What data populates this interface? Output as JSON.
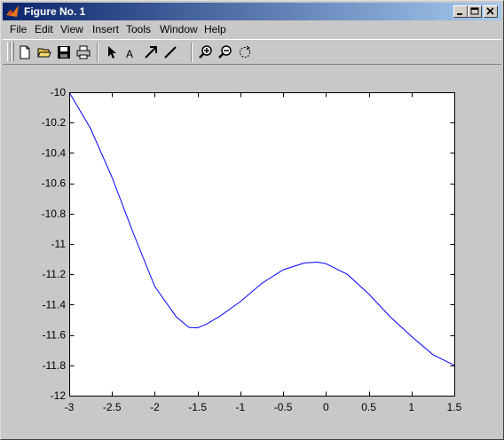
{
  "window": {
    "title": "Figure No. 1"
  },
  "menu": {
    "items": [
      "File",
      "Edit",
      "View",
      "Insert",
      "Tools",
      "Window",
      "Help"
    ]
  },
  "toolbar": {
    "buttons": [
      {
        "name": "new-figure-button",
        "icon": "new-file-icon"
      },
      {
        "name": "open-file-button",
        "icon": "open-folder-icon"
      },
      {
        "name": "save-button",
        "icon": "save-icon"
      },
      {
        "name": "print-button",
        "icon": "print-icon"
      },
      {
        "name": "edit-plot-button",
        "icon": "arrow-pointer-icon"
      },
      {
        "name": "insert-text-button",
        "icon": "text-icon",
        "label": "A"
      },
      {
        "name": "insert-arrow-button",
        "icon": "arrow-icon"
      },
      {
        "name": "insert-line-button",
        "icon": "line-icon"
      },
      {
        "name": "zoom-in-button",
        "icon": "zoom-in-icon"
      },
      {
        "name": "zoom-out-button",
        "icon": "zoom-out-icon"
      },
      {
        "name": "rotate-button",
        "icon": "rotate-icon"
      }
    ]
  },
  "chart_data": {
    "type": "line",
    "title": "",
    "xlabel": "",
    "ylabel": "",
    "xlim": [
      -3,
      1.5
    ],
    "ylim": [
      -12,
      -10
    ],
    "xticks": [
      -3,
      -2.5,
      -2,
      -1.5,
      -1,
      -0.5,
      0,
      0.5,
      1,
      1.5
    ],
    "xtick_labels": [
      "-3",
      "-2.5",
      "-2",
      "-1.5",
      "-1",
      "-0.5",
      "0",
      "0.5",
      "1",
      "1.5"
    ],
    "yticks": [
      -10,
      -10.2,
      -10.4,
      -10.6,
      -10.8,
      -11,
      -11.2,
      -11.4,
      -11.6,
      -11.8,
      -12
    ],
    "ytick_labels": [
      "-10",
      "-10.2",
      "-10.4",
      "-10.6",
      "-10.8",
      "-11",
      "-11.2",
      "-11.4",
      "-11.6",
      "-11.8",
      "-12"
    ],
    "grid": false,
    "line_color": "#0000ff",
    "series": [
      {
        "x": [
          -3,
          -2.75,
          -2.5,
          -2.25,
          -2.0,
          -1.75,
          -1.6,
          -1.5,
          -1.4,
          -1.25,
          -1.0,
          -0.75,
          -0.5,
          -0.25,
          -0.1,
          0.0,
          0.25,
          0.5,
          0.75,
          1.0,
          1.25,
          1.5
        ],
        "y": [
          -10.0,
          -10.24,
          -10.56,
          -10.93,
          -11.28,
          -11.48,
          -11.55,
          -11.553,
          -11.53,
          -11.48,
          -11.38,
          -11.26,
          -11.17,
          -11.125,
          -11.12,
          -11.13,
          -11.2,
          -11.33,
          -11.48,
          -11.61,
          -11.73,
          -11.8
        ]
      }
    ]
  }
}
